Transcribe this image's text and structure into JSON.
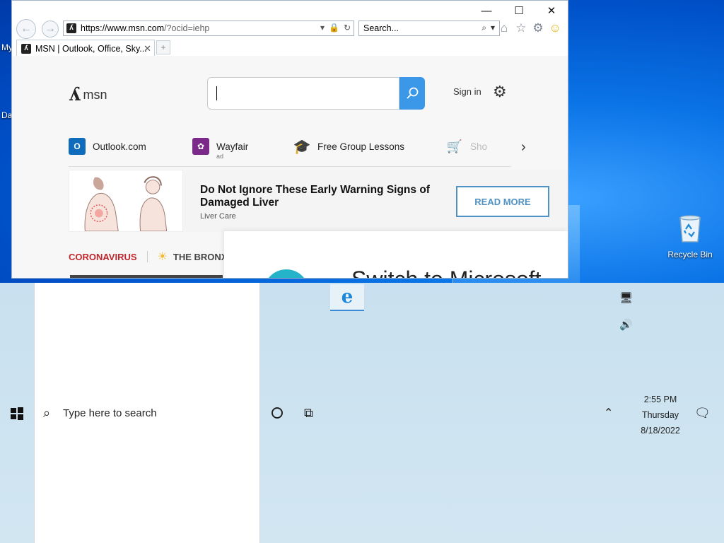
{
  "desktop": {
    "left_labels": [
      "My",
      "Da"
    ],
    "recycle_bin_label": "Recycle Bin"
  },
  "ie": {
    "caption_buttons": {
      "minimize": "—",
      "maximize": "☐",
      "close": "✕"
    },
    "address": {
      "host": "https://www.msn.com",
      "rest": "/?ocid=iehp"
    },
    "search_placeholder": "Search...",
    "tab": {
      "title": "MSN | Outlook, Office, Sky...",
      "close": "✕"
    },
    "toolbar_icons": [
      "home-icon",
      "favorites-star-icon",
      "tools-gear-icon",
      "feedback-smiley-icon"
    ]
  },
  "msn": {
    "logo_text": "msn",
    "sign_in": "Sign in",
    "quicklinks": [
      {
        "label": "Outlook.com",
        "sub": "",
        "icon": "outlook-icon",
        "color": "#0f6cbd"
      },
      {
        "label": "Wayfair",
        "sub": "ad",
        "icon": "wayfair-icon",
        "color": "#7b2a8a"
      },
      {
        "label": "Free Group Lessons",
        "sub": "",
        "icon": "graduation-cap-icon",
        "color": "#5b2c83"
      },
      {
        "label": "Sho",
        "sub": "",
        "icon": "shopping-cart-icon",
        "color": "#2a8ff7"
      }
    ],
    "ad": {
      "title": "Do Not Ignore These Early Warning Signs of Damaged Liver",
      "sponsor": "Liver Care",
      "button": "READ MORE"
    },
    "topics": {
      "first": "CORONAVIRUS",
      "second": "THE BRONX"
    },
    "overlay_text": "Switch to Microsoft"
  },
  "taskbar": {
    "search_placeholder": "Type here to search",
    "clock": {
      "time": "2:55 PM",
      "day": "Thursday",
      "date": "8/18/2022"
    }
  },
  "colors": {
    "accent": "#3b97e8",
    "corona": "#c1272d",
    "read_more": "#4f93c6"
  }
}
